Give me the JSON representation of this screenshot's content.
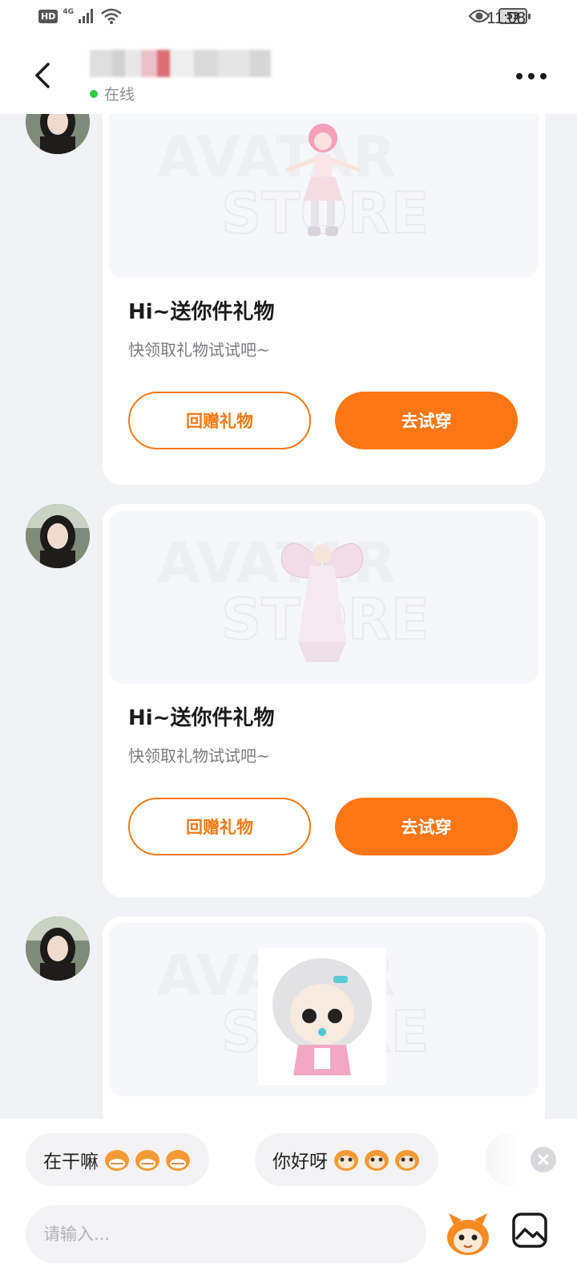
{
  "status_bar": {
    "hd": "HD",
    "network": "4G",
    "battery": "53",
    "time": "11:08"
  },
  "header": {
    "contact_name": "",
    "online_status": "在线"
  },
  "messages": [
    {
      "title": "Hi~送你件礼物",
      "subtitle": "快领取礼物试试吧~",
      "return_gift_label": "回赠礼物",
      "try_on_label": "去试穿"
    },
    {
      "title": "Hi~送你件礼物",
      "subtitle": "快领取礼物试试吧~",
      "return_gift_label": "回赠礼物",
      "try_on_label": "去试穿"
    }
  ],
  "watermark": {
    "line1": "AVATAR",
    "line2": "STORE"
  },
  "quick_replies": [
    {
      "text": "在干嘛"
    },
    {
      "text": "你好呀"
    }
  ],
  "composer": {
    "placeholder": "请输入..."
  },
  "colors": {
    "accent": "#fb7614",
    "online": "#2ecc40"
  }
}
